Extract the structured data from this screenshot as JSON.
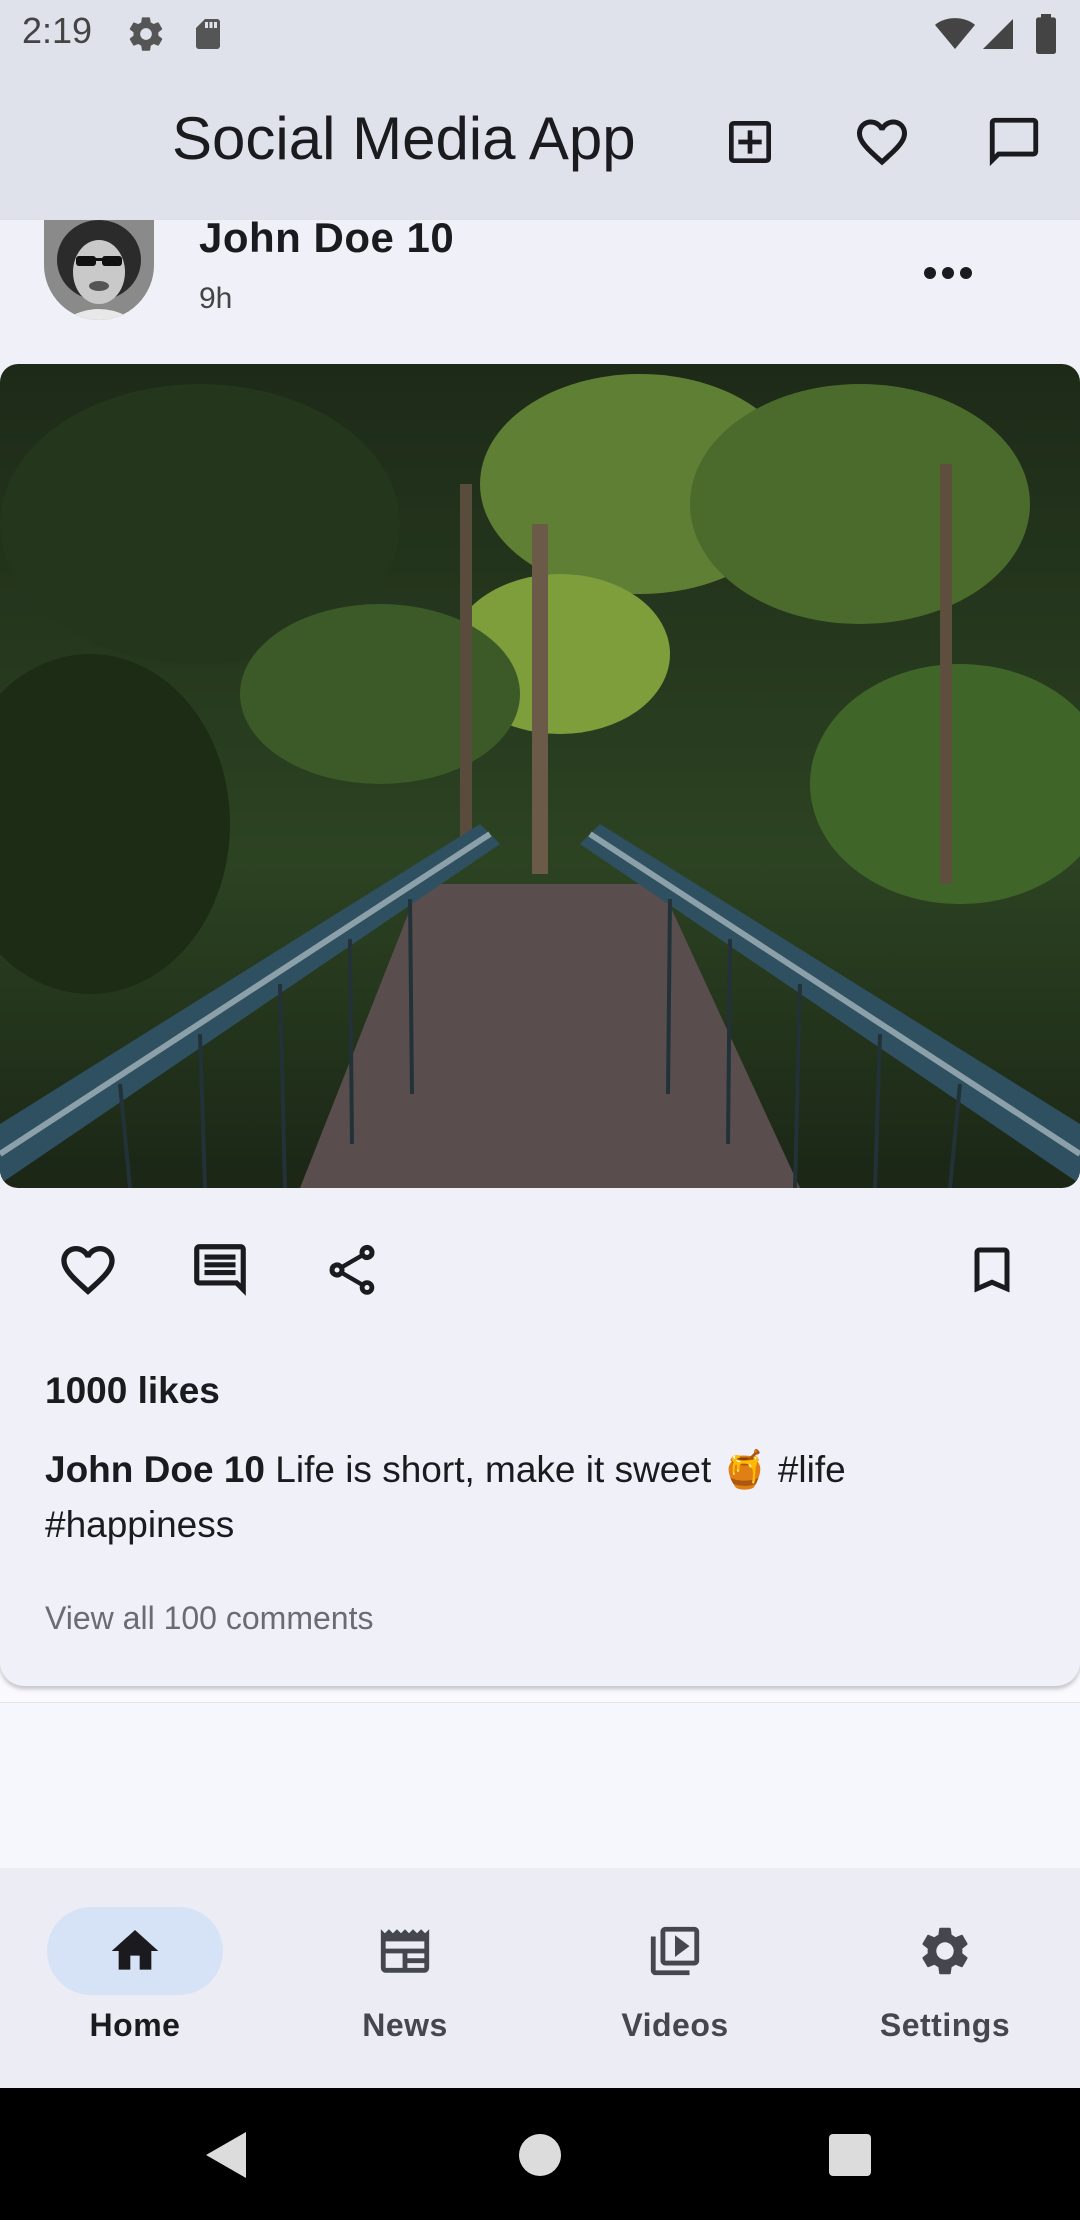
{
  "status_bar": {
    "time": "2:19",
    "icons": [
      "settings-icon",
      "sd-card-icon",
      "wifi-icon",
      "signal-icon",
      "battery-icon"
    ]
  },
  "app_bar": {
    "title": "Social Media App",
    "actions": [
      "add-box-icon",
      "heart-outline-icon",
      "chat-bubble-icon"
    ]
  },
  "post": {
    "author": "John Doe 10",
    "time": "9h",
    "image_alt": "forest-bridge-photo",
    "likes": "1000 likes",
    "caption_author": "John Doe 10",
    "caption_text": " Life is short, make it sweet 🍯 #life #happiness",
    "view_comments": "View all 100 comments",
    "actions": [
      "heart-outline-icon",
      "comment-icon",
      "share-icon",
      "bookmark-icon"
    ]
  },
  "bottom_nav": {
    "items": [
      {
        "label": "Home",
        "icon": "home-icon",
        "active": true
      },
      {
        "label": "News",
        "icon": "news-icon",
        "active": false
      },
      {
        "label": "Videos",
        "icon": "video-library-icon",
        "active": false
      },
      {
        "label": "Settings",
        "icon": "settings-icon",
        "active": false
      }
    ]
  },
  "colors": {
    "app_bar_bg": "#dfe2ea",
    "card_bg": "#f0f1f8",
    "active_pill": "#d6e3f7",
    "nav_bg": "#ecedf4"
  }
}
